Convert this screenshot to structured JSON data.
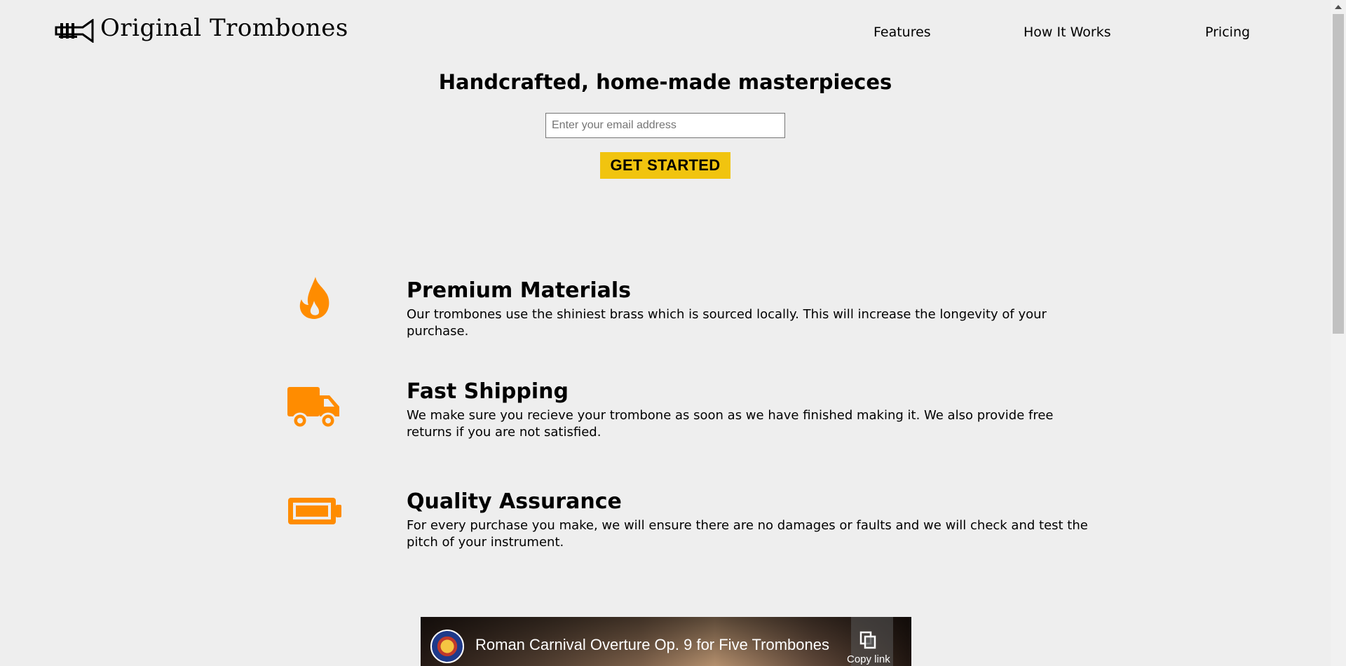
{
  "header": {
    "brand": "Original Trombones",
    "logo_icon": "trumpet-icon",
    "nav": [
      {
        "label": "Features"
      },
      {
        "label": "How It Works"
      },
      {
        "label": "Pricing"
      }
    ]
  },
  "hero": {
    "title": "Handcrafted, home-made masterpieces",
    "email_placeholder": "Enter your email address",
    "cta_label": "GET STARTED",
    "cta_color": "#f1c40f"
  },
  "features": [
    {
      "icon": "fire-icon",
      "title": "Premium Materials",
      "description": "Our trombones use the shiniest brass which is sourced locally. This will increase the longevity of your purchase."
    },
    {
      "icon": "truck-icon",
      "title": "Fast Shipping",
      "description": "We make sure you recieve your trombone as soon as we have finished making it. We also provide free returns if you are not satisfied."
    },
    {
      "icon": "battery-icon",
      "title": "Quality Assurance",
      "description": "For every purchase you make, we will ensure there are no damages or faults and we will check and test the pitch of your instrument."
    }
  ],
  "accent_color": "#ff8c00",
  "video": {
    "title": "Roman Carnival Overture Op. 9 for Five Trombones",
    "copy_label": "Copy link"
  }
}
